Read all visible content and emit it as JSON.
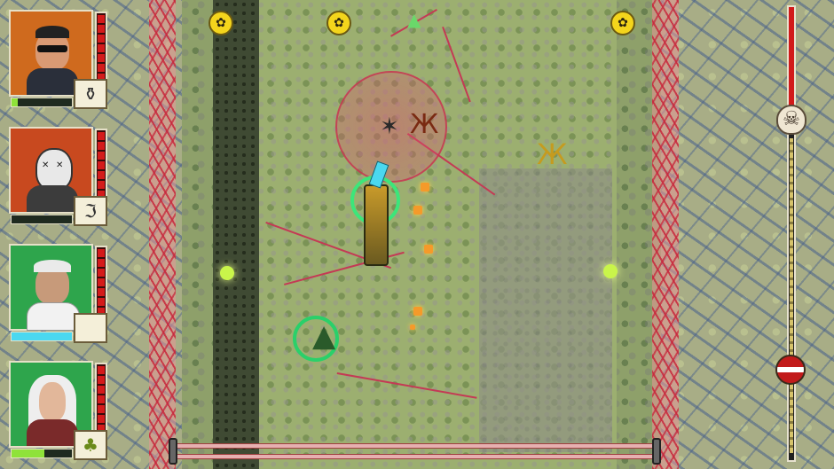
{
  "game": {
    "colors": {
      "health_red": "#d41b1b",
      "energy_green": "#8fe23a",
      "energy_cyan": "#4ad8f0",
      "ally_ring_green": "#3ce67a",
      "coin_yellow": "#f4d51c",
      "attack_zone_pink": "#dc506e"
    },
    "party": [
      {
        "name": "sunglasses-hero",
        "frame_color": "#cf6a1e",
        "health_fraction": 1.0,
        "energy_fraction": 0.1,
        "energy_color": "#8fe23a",
        "item_icon": "potion-bag-icon",
        "item_glyph": "⚱"
      },
      {
        "name": "skull-masked-hero",
        "frame_color": "#c8491f",
        "health_fraction": 1.0,
        "energy_fraction": 0.0,
        "energy_color": "#8fe23a",
        "item_icon": "glyph-rune-icon",
        "item_glyph": "ℑ"
      },
      {
        "name": "old-scientist-hero",
        "frame_color": "#2ea54c",
        "health_fraction": 1.0,
        "energy_fraction": 1.0,
        "energy_color": "#4ad8f0",
        "item_icon": "empty-slot-icon",
        "item_glyph": ""
      },
      {
        "name": "white-haired-warrior-hero",
        "frame_color": "#2ea54c",
        "health_fraction": 1.0,
        "energy_fraction": 0.55,
        "energy_color": "#8fe23a",
        "item_icon": "pineapple-grenade-icon",
        "item_glyph": "♣"
      }
    ],
    "coins": [
      {
        "icon": "clover-coin-icon",
        "glyph": "✿"
      },
      {
        "icon": "clover-coin-icon",
        "glyph": "✿"
      },
      {
        "icon": "clover-coin-icon",
        "glyph": "✿"
      }
    ],
    "level_progress": {
      "danger_fraction": 0.23,
      "player_position_fraction": 0.83,
      "boss_icon": "skull-icon",
      "boss_glyph": "☠"
    },
    "icons": {
      "direction_arrow": "▲",
      "enemy_glyph": "✶",
      "cannon_glyph": "Ж"
    }
  }
}
